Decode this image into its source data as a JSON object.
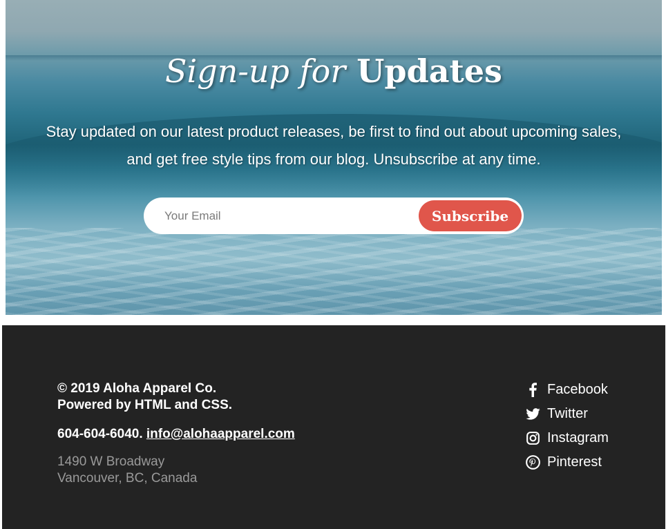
{
  "signup": {
    "title_lead": "Sign-up for",
    "title_main": "Updates",
    "description_line1": "Stay updated on our latest product releases, be first to find out about upcoming sales,",
    "description_line2": "and get free style tips from our blog. Unsubscribe at any time.",
    "email_placeholder": "Your Email",
    "subscribe_label": "Subscribe",
    "accent_color": "#e0564b"
  },
  "footer": {
    "copyright": "© 2019 Aloha Apparel Co.",
    "powered_by": "Powered by HTML and CSS.",
    "phone": "604-604-6040.",
    "email": "info@alohaapparel.com",
    "address_line1": "1490 W Broadway",
    "address_line2": "Vancouver, BC, Canada",
    "background_color": "#232323",
    "social": [
      {
        "label": "Facebook",
        "icon": "facebook-icon"
      },
      {
        "label": "Twitter",
        "icon": "twitter-icon"
      },
      {
        "label": "Instagram",
        "icon": "instagram-icon"
      },
      {
        "label": "Pinterest",
        "icon": "pinterest-icon"
      }
    ]
  }
}
